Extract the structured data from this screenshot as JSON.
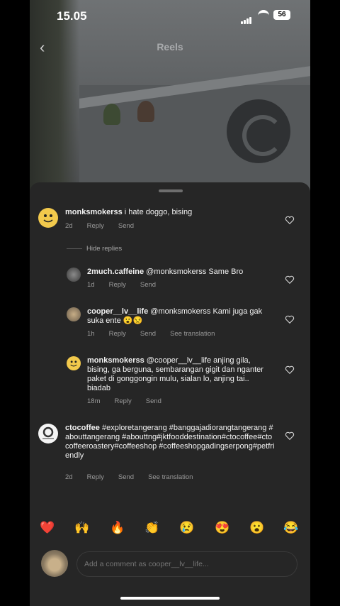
{
  "status_bar": {
    "time": "15.05",
    "battery": "56"
  },
  "header": {
    "title": "Reels"
  },
  "comments": [
    {
      "username": "monksmokerss",
      "text": "i hate doggo, bising",
      "age": "2d",
      "reply": "Reply",
      "send": "Send"
    },
    {
      "username": "2much.caffeine",
      "text": "@monksmokerss Same Bro",
      "age": "1d",
      "reply": "Reply",
      "send": "Send"
    },
    {
      "username": "cooper__lv__life",
      "text": "@monksmokerss Kami juga gak suka ente 😮😒",
      "age": "1h",
      "reply": "Reply",
      "send": "Send",
      "translate": "See translation"
    },
    {
      "username": "monksmokerss",
      "text": "@cooper__lv__life anjing gila, bising, ga berguna, sembarangan gigit dan nganter paket di gonggongin mulu, sialan lo, anjing tai.. biadab",
      "age": "18m",
      "reply": "Reply",
      "send": "Send"
    },
    {
      "username": "ctocoffee",
      "text": "#exploretangerang #banggajadiorangtangerang #abouttangerang #abouttng#jktfooddestination#ctocoffee#ctocoffeeroastery#coffeeshop #coffeeshopgadingserpong#petfriendly",
      "age": "2d",
      "reply": "Reply",
      "send": "Send",
      "translate": "See translation"
    }
  ],
  "hide_replies": "Hide replies",
  "emojis": [
    "❤️",
    "🙌",
    "🔥",
    "👏",
    "😢",
    "😍",
    "😮",
    "😂"
  ],
  "composer": {
    "placeholder": "Add a comment as cooper__lv__life..."
  }
}
